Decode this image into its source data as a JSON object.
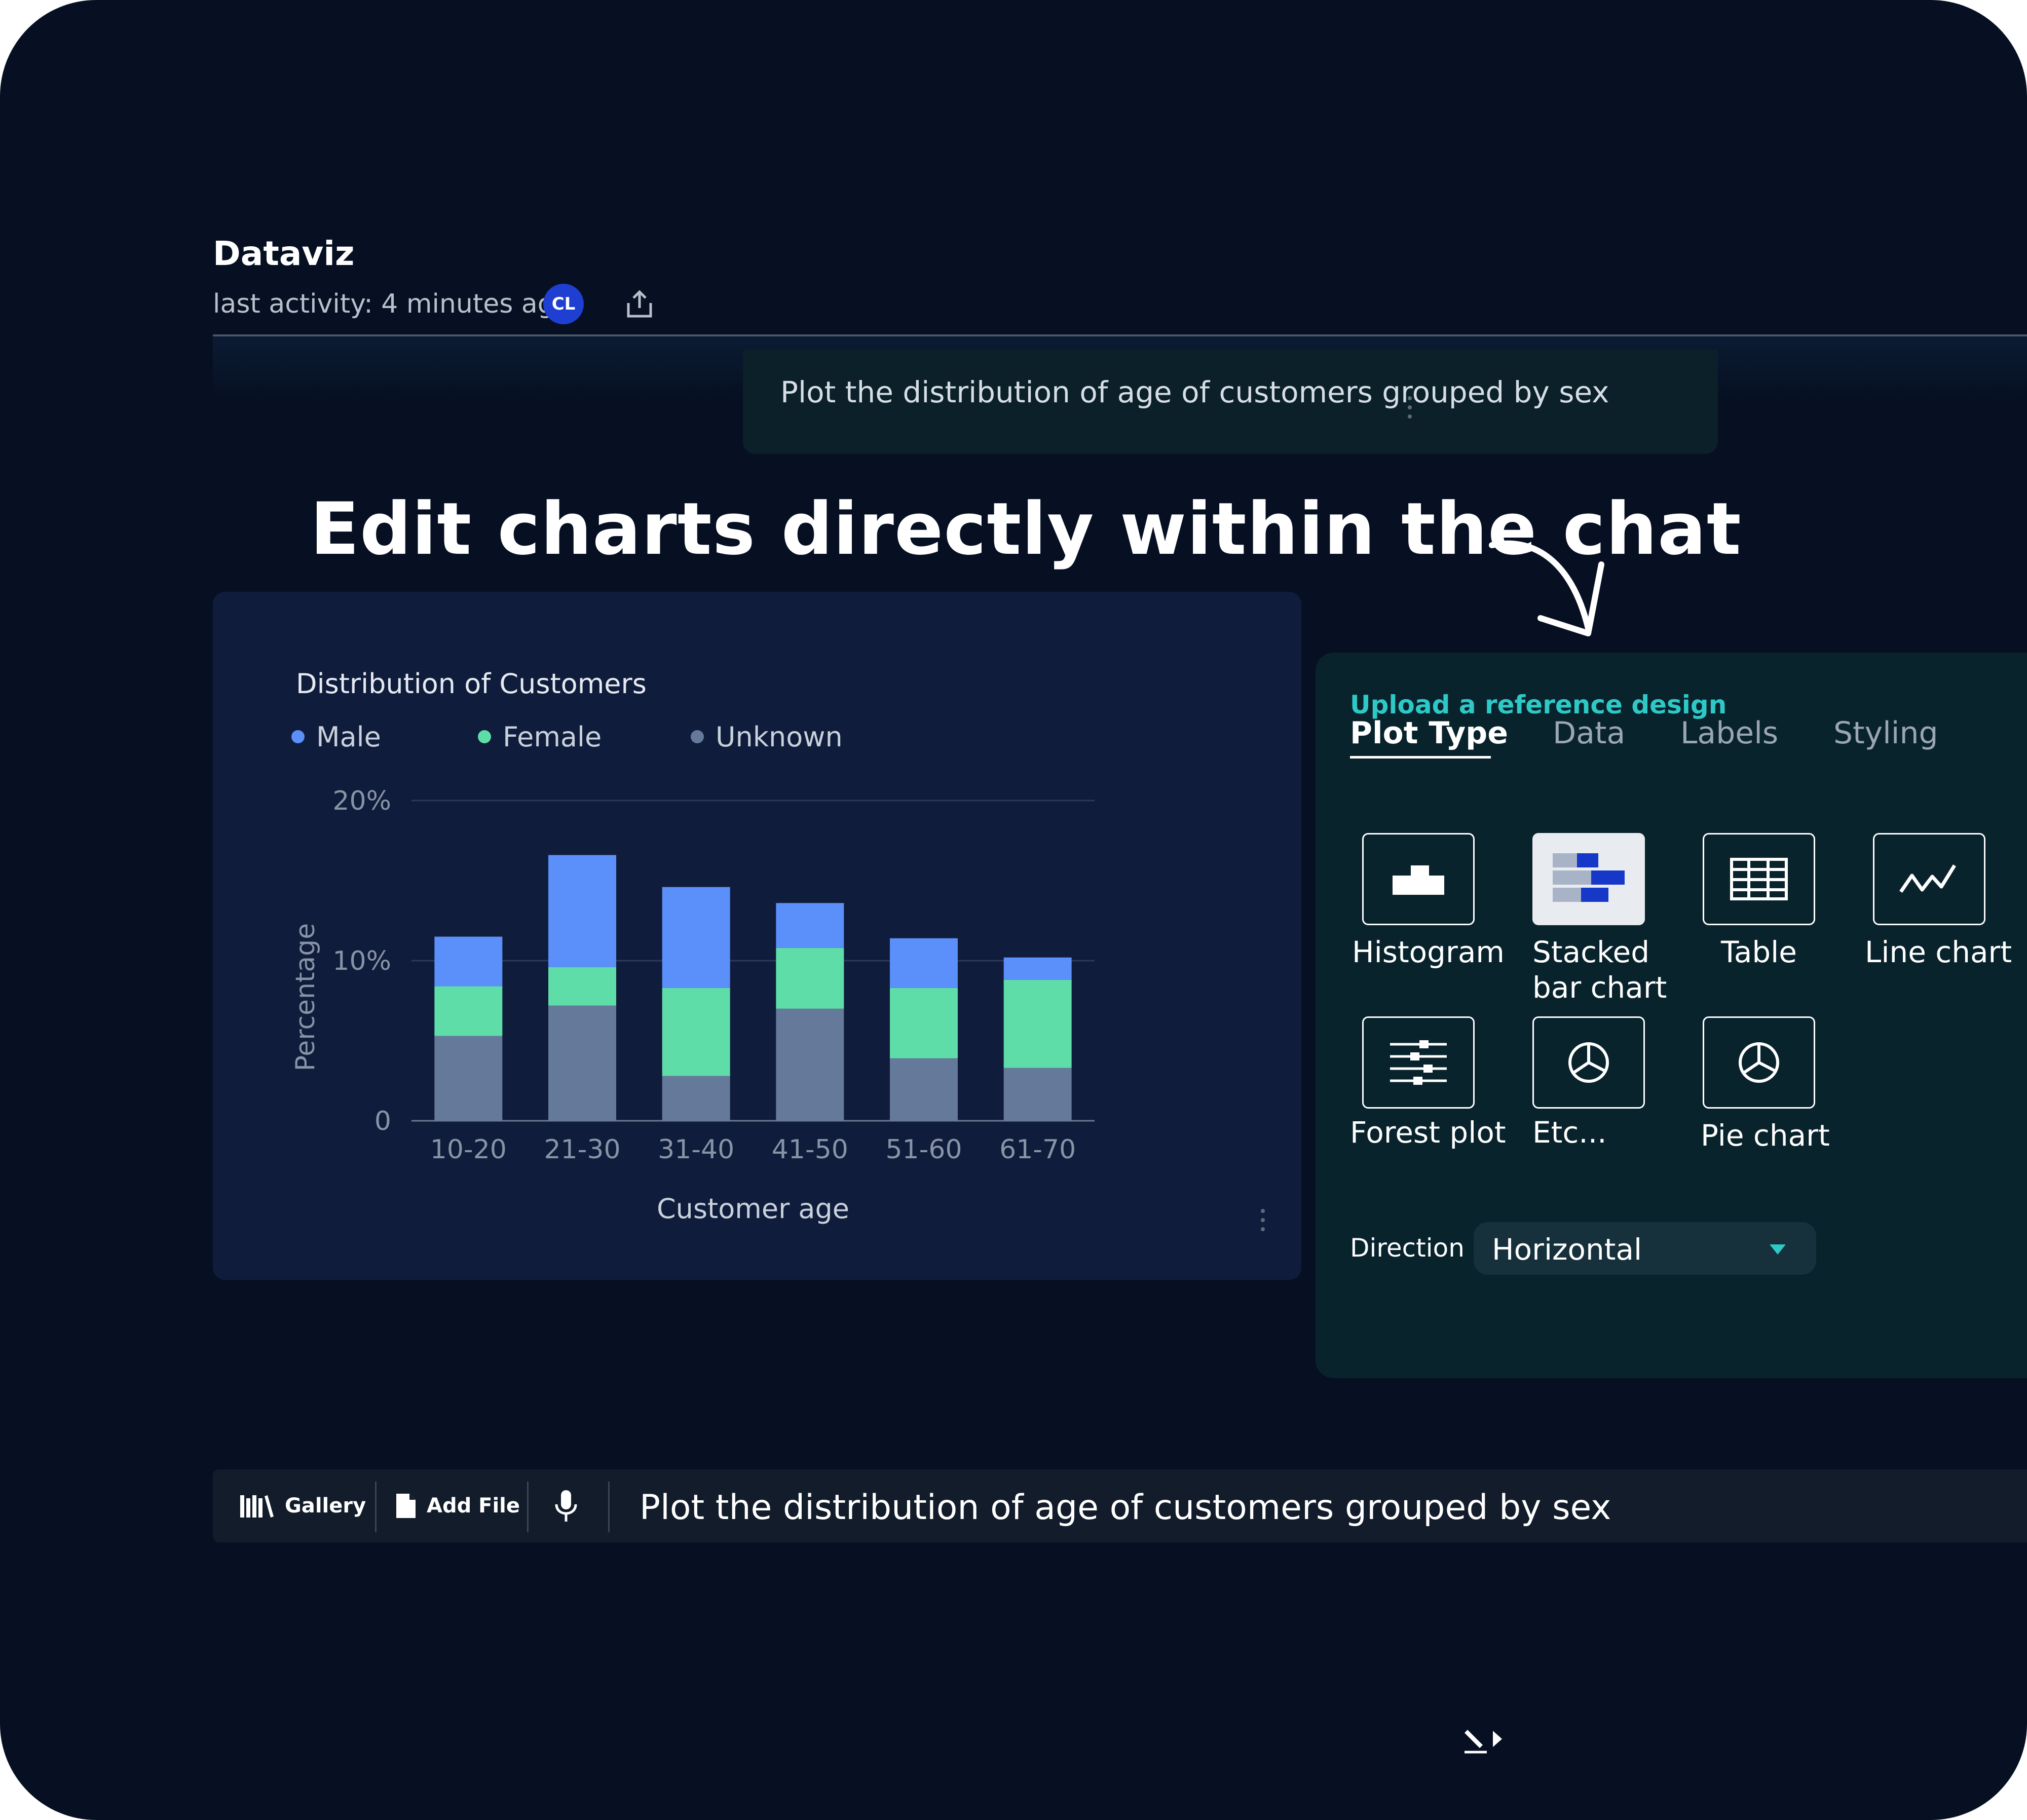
{
  "header": {
    "title": "Dataviz",
    "activity": "last activity: 4 minutes ago",
    "avatar_initials": "CL"
  },
  "user_message": {
    "text": "Plot the distribution of age of customers grouped by sex"
  },
  "headline": "Edit charts directly within the chat",
  "chart_data": {
    "type": "bar",
    "stacked": true,
    "title": "Distribution of Customers",
    "xlabel": "Customer age",
    "ylabel": "Percentage",
    "categories": [
      "10-20",
      "21-30",
      "31-40",
      "41-50",
      "51-60",
      "61-70"
    ],
    "series": [
      {
        "name": "Unknown",
        "color": "#65799b",
        "values": [
          5.3,
          7.2,
          2.8,
          7.0,
          3.9,
          3.3
        ]
      },
      {
        "name": "Female",
        "color": "#5edda8",
        "values": [
          3.1,
          2.4,
          5.5,
          3.8,
          4.4,
          5.5
        ]
      },
      {
        "name": "Male",
        "color": "#5b8ff9",
        "values": [
          3.1,
          7.0,
          6.3,
          2.8,
          3.1,
          1.4
        ]
      }
    ],
    "legend_order": [
      "Male",
      "Female",
      "Unknown"
    ],
    "legend_position": "top-left",
    "y_ticks": [
      "0",
      "10%",
      "20%"
    ],
    "ylim": [
      0,
      20
    ],
    "grid": true
  },
  "panel": {
    "upload_link": "Upload a reference design",
    "tabs": [
      "Plot Type",
      "Data",
      "Labels",
      "Styling"
    ],
    "active_tab": "Plot Type",
    "plot_types": [
      {
        "label": "Histogram",
        "icon": "histogram-icon"
      },
      {
        "label": "Stacked bar chart",
        "line1": "Stacked",
        "line2": "bar chart",
        "icon": "stacked-bar-icon",
        "selected": true
      },
      {
        "label": "Table",
        "icon": "table-icon"
      },
      {
        "label": "Line chart",
        "icon": "line-chart-icon"
      },
      {
        "label": "Forest plot",
        "icon": "forest-plot-icon"
      },
      {
        "label": "Etc...",
        "icon": "pie-icon"
      },
      {
        "label": "Pie chart",
        "icon": "pie-icon"
      }
    ],
    "direction_label": "Direction",
    "direction_value": "Horizontal"
  },
  "input_bar": {
    "gallery_label": "Gallery",
    "add_file_label": "Add File",
    "text": "Plot the distribution of age of customers grouped by sex"
  },
  "colors": {
    "background": "#061022",
    "accent": "#2ec9c6",
    "avatar": "#1f3fd2"
  }
}
